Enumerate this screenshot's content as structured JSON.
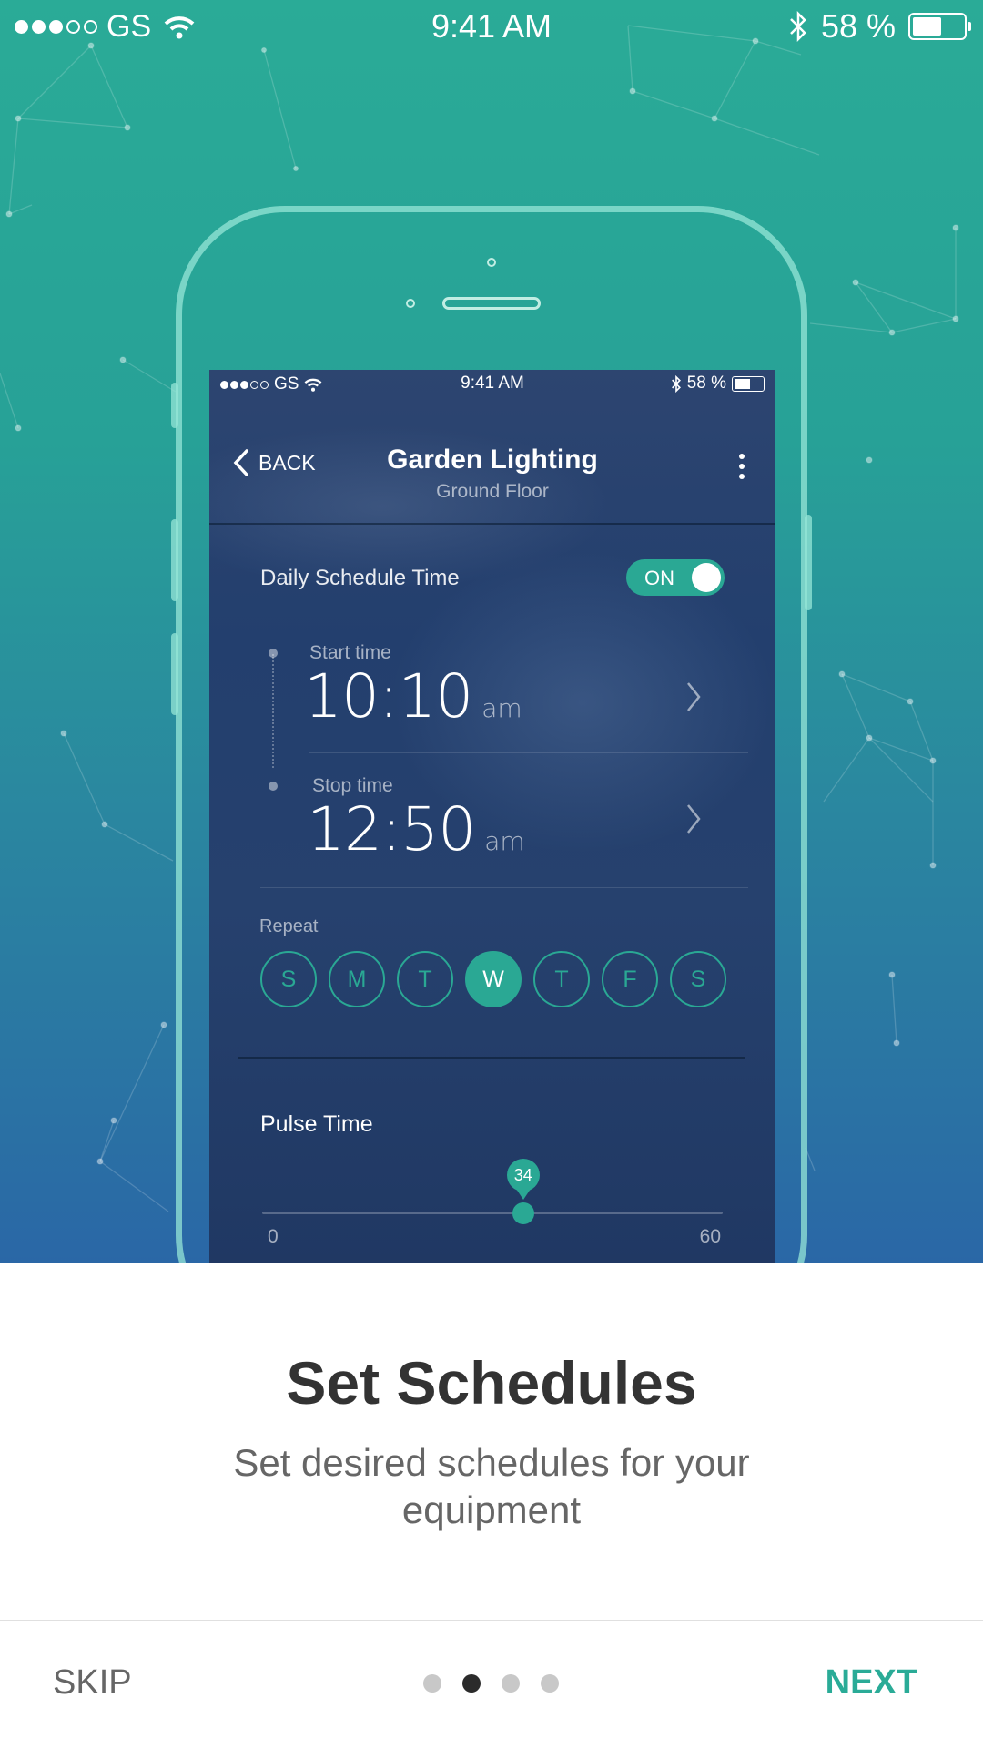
{
  "status_bar": {
    "carrier": "GS",
    "time": "9:41 AM",
    "battery": "58 %",
    "battery_level": 0.58
  },
  "device_screen": {
    "status_bar": {
      "carrier": "GS",
      "time": "9:41 AM",
      "battery": "58 %",
      "battery_level": 0.58
    },
    "nav": {
      "back_label": "BACK",
      "title": "Garden Lighting",
      "subtitle": "Ground Floor"
    },
    "schedule": {
      "label": "Daily Schedule Time",
      "toggle_label": "ON",
      "enabled": true
    },
    "start_time": {
      "caption": "Start time",
      "value": "10:10",
      "meridiem": "am"
    },
    "stop_time": {
      "caption": "Stop time",
      "value": "12:50",
      "meridiem": "am"
    },
    "repeat": {
      "label": "Repeat",
      "days": [
        "S",
        "M",
        "T",
        "W",
        "T",
        "F",
        "S"
      ],
      "selected_index": 3
    },
    "pulse": {
      "label": "Pulse Time",
      "value": "34",
      "min": "0",
      "max": "60",
      "fraction": 0.5667
    }
  },
  "onboarding": {
    "title": "Set Schedules",
    "description": "Set desired schedules for your equipment"
  },
  "footer": {
    "skip_label": "SKIP",
    "next_label": "NEXT",
    "page_count": 4,
    "current_page": 2
  },
  "colors": {
    "accent": "#2aab97",
    "screen_bg": "#233f6e"
  }
}
